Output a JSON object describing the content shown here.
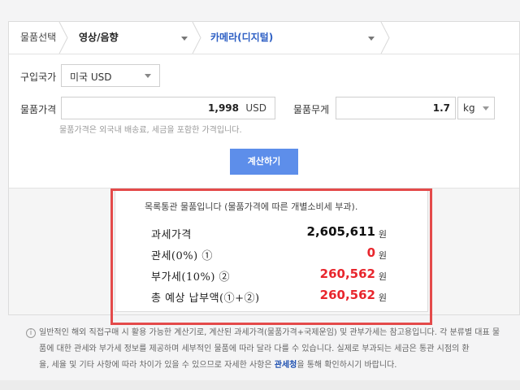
{
  "breadcrumb": {
    "label": "물품선택",
    "category1": "영상/음향",
    "category2": "카메라(디지털)"
  },
  "form": {
    "country_label": "구입국가",
    "country_value": "미국 USD",
    "price_label": "물품가격",
    "price_value": "1,998",
    "price_unit": "USD",
    "weight_label": "물품무게",
    "weight_value": "1.7",
    "weight_unit": "kg",
    "help_text": "물품가격은 외국내 배송료, 세금을 포함한 가격입니다.",
    "calc_button": "계산하기"
  },
  "result": {
    "note": "목록통관 물품입니다 (물품가격에 따른 개별소비세 부과).",
    "rows": [
      {
        "label": "과세가격",
        "value": "2,605,611",
        "unit": "원",
        "color": "#111111"
      },
      {
        "label": "관세(0%) ①",
        "value": "0",
        "unit": "원",
        "color": "#e8262d"
      },
      {
        "label": "부가세(10%) ②",
        "value": "260,562",
        "unit": "원",
        "color": "#e8262d"
      },
      {
        "label": "총 예상 납부액(①+②)",
        "value": "260,562",
        "unit": "원",
        "color": "#e8262d"
      }
    ]
  },
  "notice": {
    "icon": "i",
    "line1": "일반적인 해외 직접구매 시 활용 가능한 계산기로, 계산된 과세가격(물품가격+국제운임) 및 관부가세는 참고용입니다. 각 분류별 대표 물",
    "line2": "품에 대한 관세와 부가세 정보를 제공하며 세부적인 물품에 따라 달라 다를 수 있습니다. 실제로 부과되는 세금은 통관 시점의 환",
    "line3_pre": "율, 세율 및 기타 사항에 따라 차이가 있을 수 있으므로 자세한 사항은 ",
    "link": "관세청",
    "line3_post": "을 통해 확인하시기 바랍니다."
  },
  "colors": {
    "accent": "#5d8eea",
    "highlight": "#e44a4a",
    "red_value": "#e8262d",
    "link": "#1d4fb0"
  }
}
